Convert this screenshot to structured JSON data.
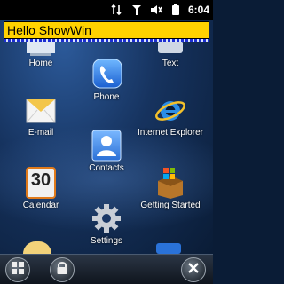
{
  "status_bar": {
    "time": "6:04",
    "icons": [
      "data-transfer-icon",
      "signal-icon",
      "volume-icon",
      "battery-icon"
    ]
  },
  "title_bar": {
    "text": "Hello ShowWin"
  },
  "tiles": [
    {
      "label": "Home",
      "icon": "home-icon"
    },
    {
      "label": "Text",
      "icon": "text-icon"
    },
    {
      "label": "Phone",
      "icon": "phone-icon"
    },
    {
      "label": "E-mail",
      "icon": "email-icon"
    },
    {
      "label": "Internet Explorer",
      "icon": "internet-explorer-icon"
    },
    {
      "label": "Contacts",
      "icon": "contacts-icon"
    },
    {
      "label": "Calendar",
      "icon": "calendar-icon",
      "day": "30"
    },
    {
      "label": "Getting Started",
      "icon": "getting-started-icon"
    },
    {
      "label": "Settings",
      "icon": "settings-icon"
    }
  ],
  "soft_keys": [
    "start-icon",
    "lock-icon",
    "close-icon"
  ],
  "colors": {
    "title_bg": "#ffd200",
    "desktop_bg": "#16335f"
  }
}
